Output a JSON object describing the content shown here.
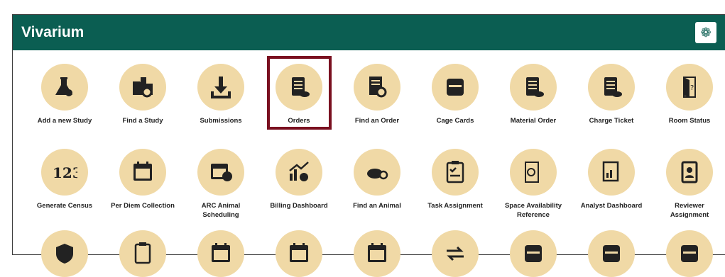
{
  "header": {
    "title": "Vivarium",
    "settings_icon": "gear-icon"
  },
  "rows": [
    [
      {
        "label": "Add a new Study",
        "icon": "flask-mouse-icon"
      },
      {
        "label": "Find a Study",
        "icon": "folder-search-icon"
      },
      {
        "label": "Submissions",
        "icon": "download-icon"
      },
      {
        "label": "Orders",
        "icon": "clipboard-mouse-icon"
      },
      {
        "label": "Find an Order",
        "icon": "document-search-icon"
      },
      {
        "label": "Cage Cards",
        "icon": "card-icon"
      },
      {
        "label": "Material Order",
        "icon": "clipboard-mouse-icon"
      },
      {
        "label": "Charge Ticket",
        "icon": "clipboard-mouse-icon"
      },
      {
        "label": "Room Status",
        "icon": "door-question-icon"
      }
    ],
    [
      {
        "label": "Generate Census",
        "icon": "census-123-icon"
      },
      {
        "label": "Per Diem Collection",
        "icon": "calendar-icon"
      },
      {
        "label": "ARC Animal\nScheduling",
        "icon": "calendar-clock-icon"
      },
      {
        "label": "Billing Dashboard",
        "icon": "chart-money-icon"
      },
      {
        "label": "Find an Animal",
        "icon": "mouse-search-icon"
      },
      {
        "label": "Task Assignment",
        "icon": "clipboard-check-icon"
      },
      {
        "label": "Space Availability\nReference",
        "icon": "door-search-icon"
      },
      {
        "label": "Analyst Dashboard",
        "icon": "report-chart-icon"
      },
      {
        "label": "Reviewer\nAssignment",
        "icon": "id-badge-icon"
      }
    ],
    [
      {
        "label": "",
        "icon": "shield-icon"
      },
      {
        "label": "",
        "icon": "clipboard-icon"
      },
      {
        "label": "",
        "icon": "calendar-icon"
      },
      {
        "label": "",
        "icon": "calendar-icon"
      },
      {
        "label": "",
        "icon": "calendar-icon"
      },
      {
        "label": "",
        "icon": "exchange-icon"
      },
      {
        "label": "",
        "icon": "card-icon"
      },
      {
        "label": "",
        "icon": "card-icon"
      },
      {
        "label": "",
        "icon": "card-icon"
      }
    ]
  ],
  "colors": {
    "header": "#0b5e52",
    "icon_bg": "#f0d9a6",
    "highlight": "#7a1020",
    "icon": "#222222"
  }
}
